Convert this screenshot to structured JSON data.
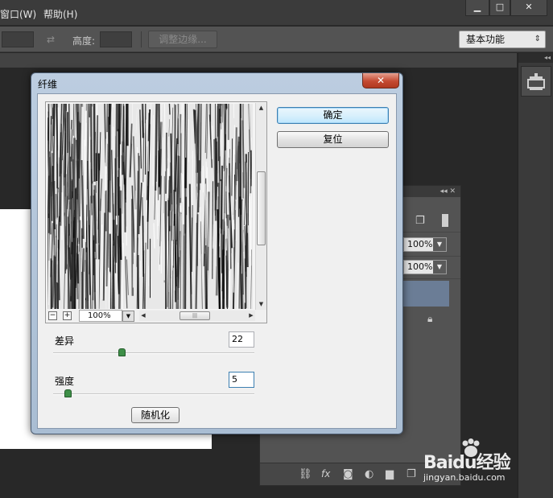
{
  "menubar": {
    "items": [
      {
        "label": "窗口(W)"
      },
      {
        "label": "帮助(H)"
      }
    ],
    "window_controls": {
      "minimize": "▁",
      "maximize": "□",
      "close": "✕"
    }
  },
  "options_bar": {
    "height_label": "高度:",
    "refine_edge_label": "调整边缘...",
    "workspace_value": "基本功能"
  },
  "layers_panel": {
    "opacity_value": "100%",
    "fill_value": "100%"
  },
  "dialog": {
    "title": "纤维",
    "ok_label": "确定",
    "reset_label": "复位",
    "zoom_value": "100%",
    "params": {
      "variance_label": "差异",
      "variance_value": "22",
      "variance_fraction": 0.34,
      "strength_label": "强度",
      "strength_value": "5",
      "strength_fraction": 0.07
    },
    "randomize_label": "随机化"
  },
  "watermark": {
    "brand": "Baidu经验",
    "url": "jingyan.baidu.com"
  },
  "colors": {
    "app_bg": "#282828",
    "selection_blue": "#6b7d96",
    "dialog_frame": "#bccde0",
    "close_red": "#c44a32",
    "slider_green": "#3e8f48"
  }
}
